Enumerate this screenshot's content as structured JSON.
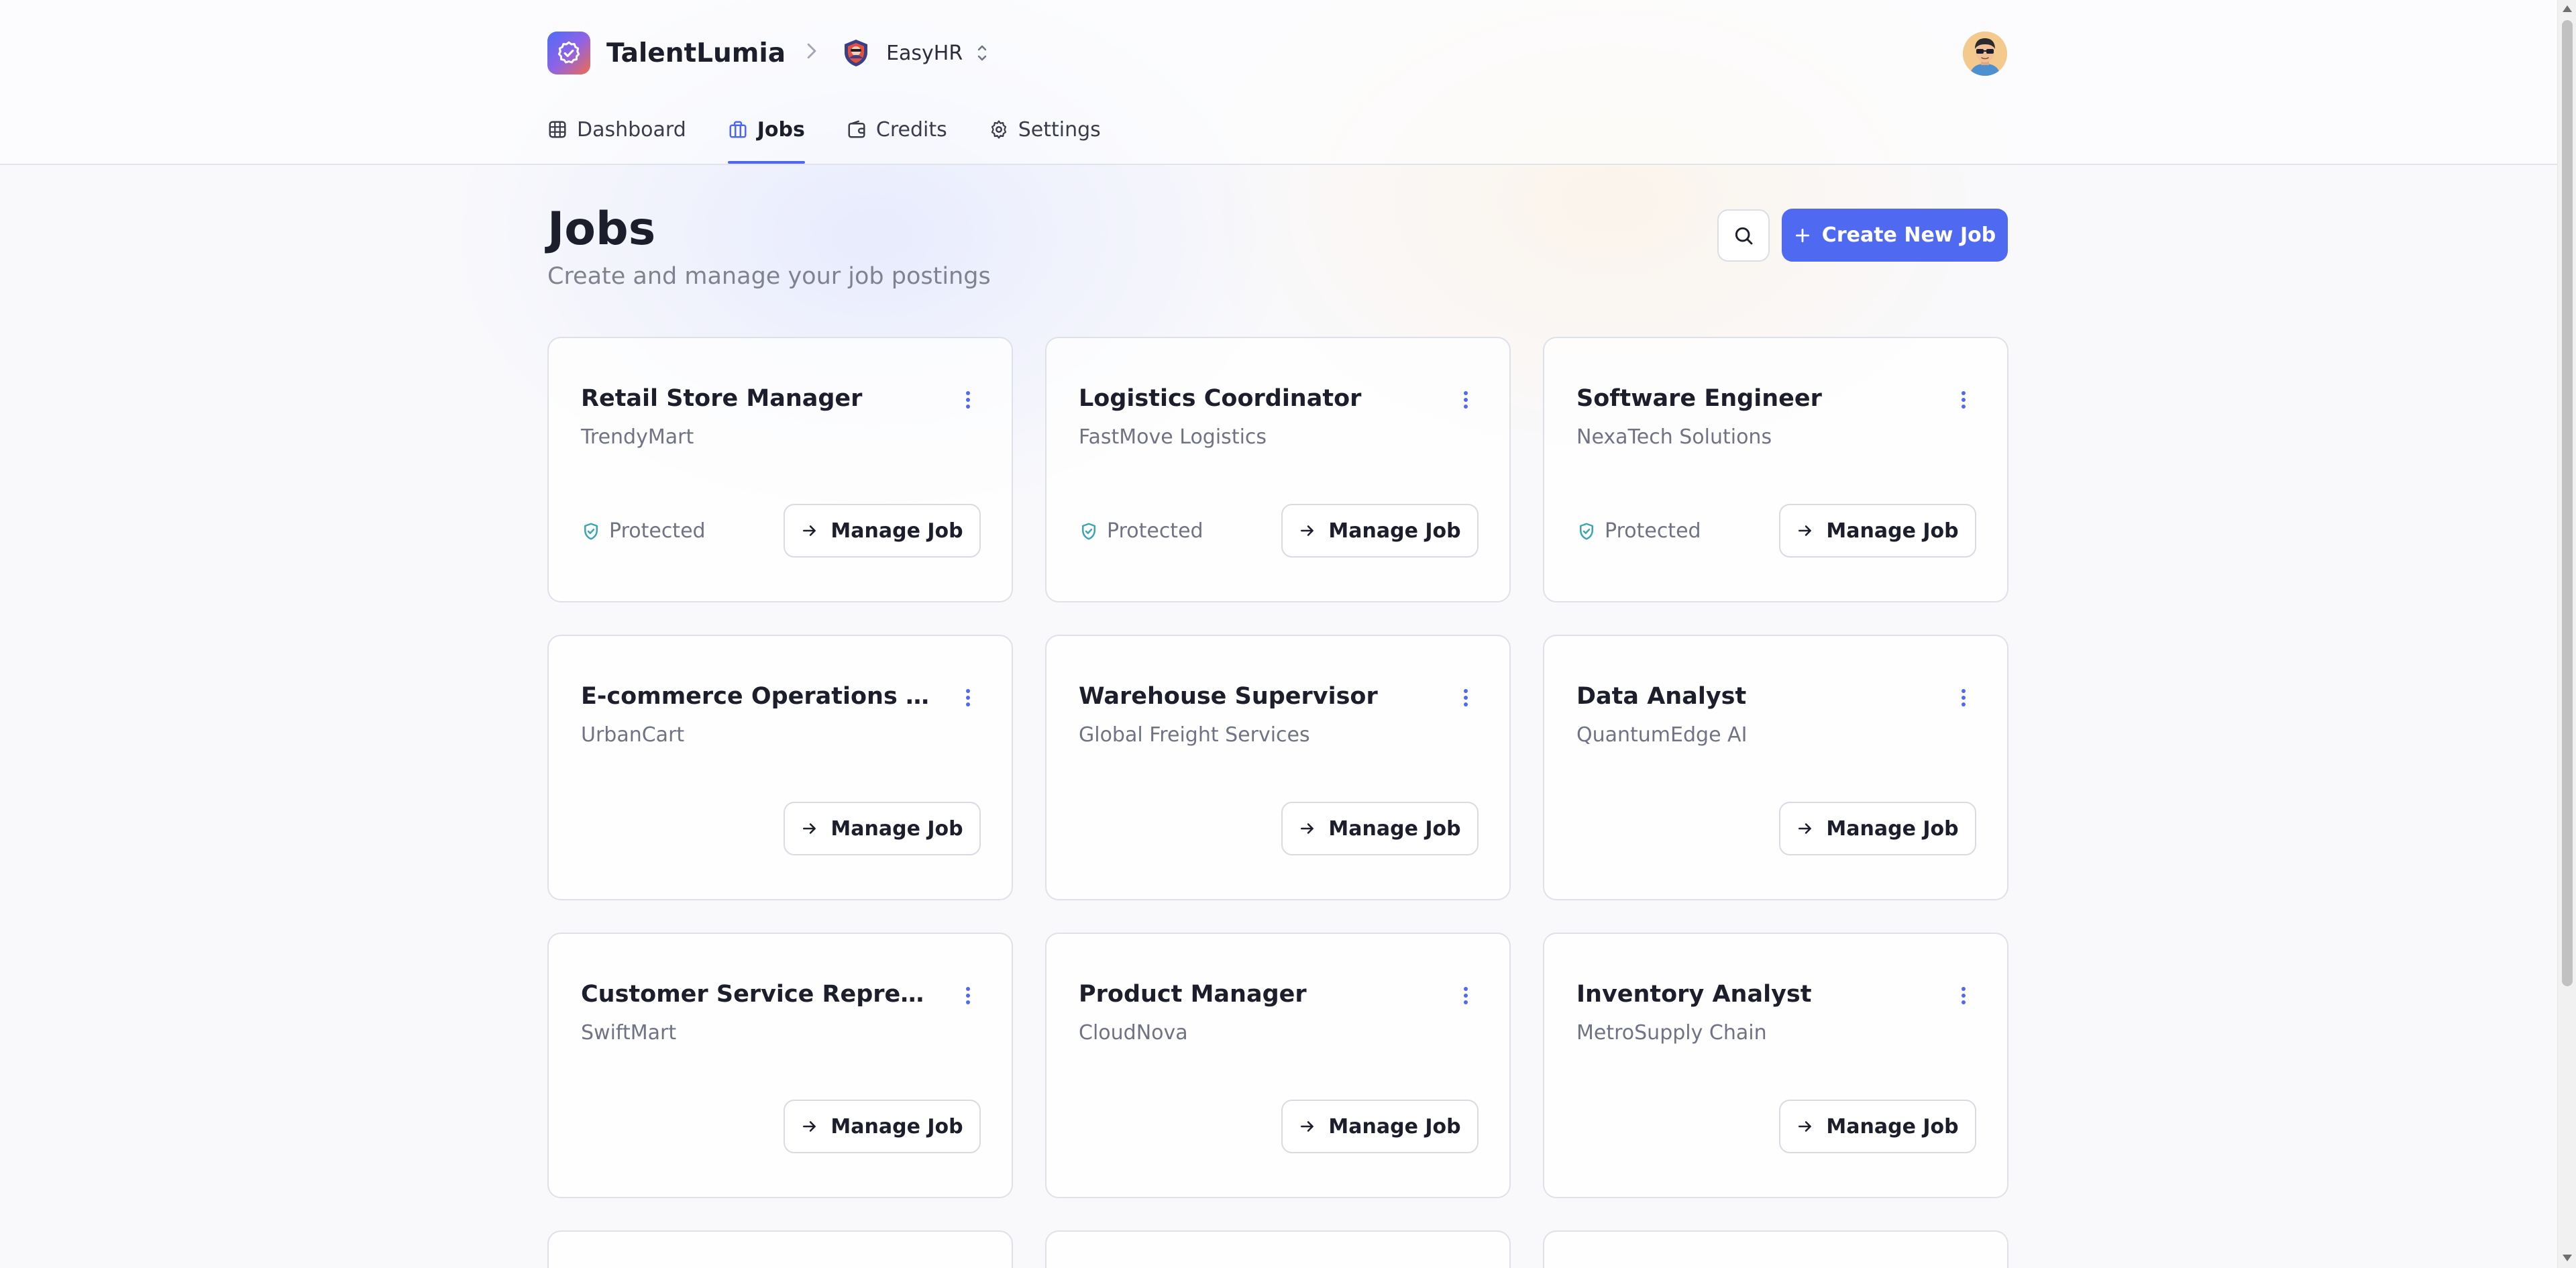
{
  "app": {
    "brand": "TalentLumia",
    "organization": "EasyHR"
  },
  "nav": {
    "items": [
      {
        "label": "Dashboard",
        "icon": "grid-icon"
      },
      {
        "label": "Jobs",
        "icon": "briefcase-icon",
        "active": true
      },
      {
        "label": "Credits",
        "icon": "wallet-icon"
      },
      {
        "label": "Settings",
        "icon": "gear-icon"
      }
    ]
  },
  "page": {
    "title": "Jobs",
    "subtitle": "Create and manage your job postings",
    "create_button": "Create New Job"
  },
  "jobs": [
    {
      "title": "Retail Store Manager",
      "company": "TrendyMart",
      "protected": "Protected",
      "action": "Manage Job"
    },
    {
      "title": "Logistics Coordinator",
      "company": "FastMove Logistics",
      "protected": "Protected",
      "action": "Manage Job"
    },
    {
      "title": "Software Engineer",
      "company": "NexaTech Solutions",
      "protected": "Protected",
      "action": "Manage Job"
    },
    {
      "title": "E-commerce Operations Spec…",
      "company": "UrbanCart",
      "action": "Manage Job"
    },
    {
      "title": "Warehouse Supervisor",
      "company": "Global Freight Services",
      "action": "Manage Job"
    },
    {
      "title": "Data Analyst",
      "company": "QuantumEdge AI",
      "action": "Manage Job"
    },
    {
      "title": "Customer Service Representa…",
      "company": "SwiftMart",
      "action": "Manage Job"
    },
    {
      "title": "Product Manager",
      "company": "CloudNova",
      "action": "Manage Job"
    },
    {
      "title": "Inventory Analyst",
      "company": "MetroSupply Chain",
      "action": "Manage Job"
    }
  ],
  "colors": {
    "accent": "#4f6af0",
    "protected_icon": "#3aa6b0",
    "menu_dots": "#4f6af0"
  }
}
